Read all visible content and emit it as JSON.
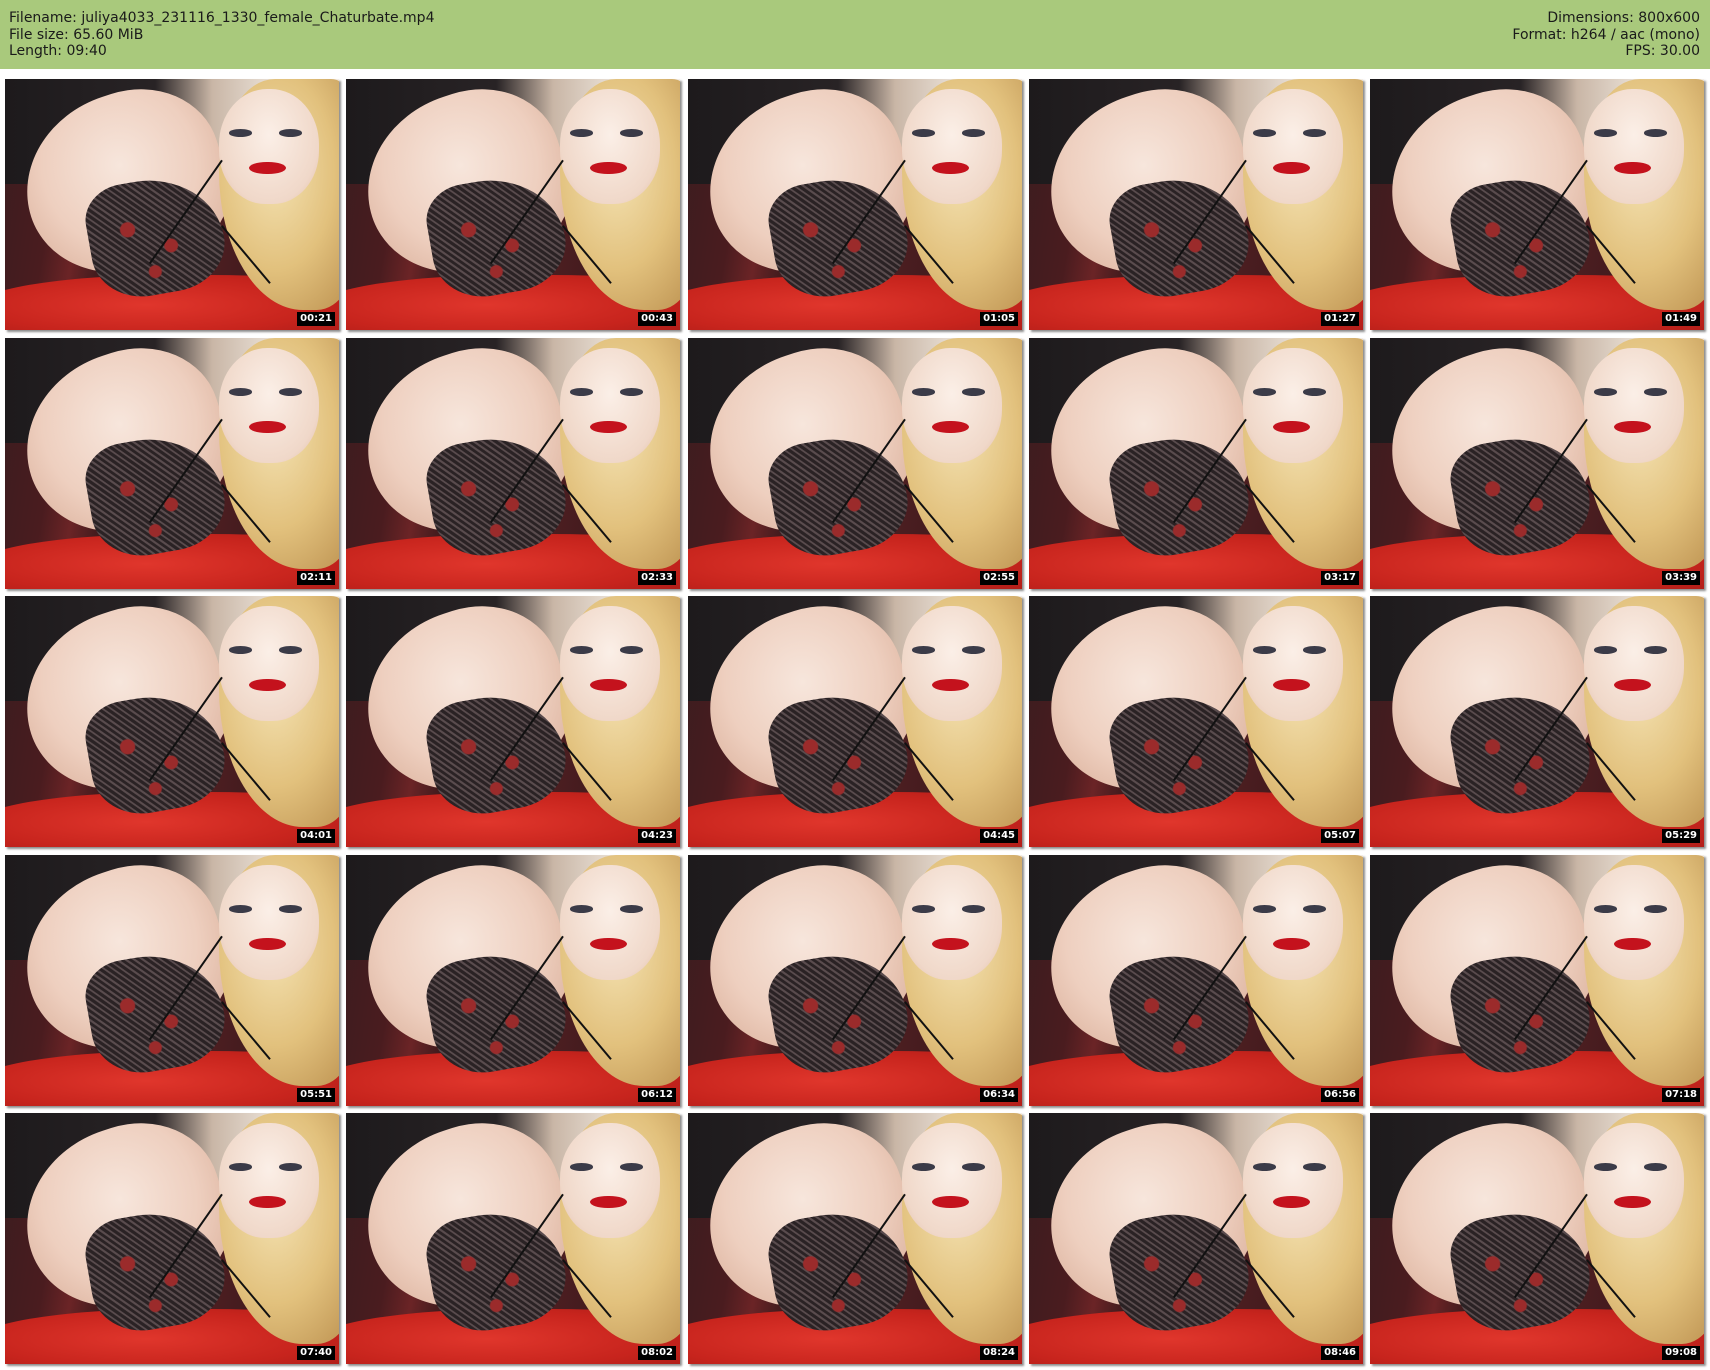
{
  "header": {
    "filename_label": "Filename:",
    "filename": "juliya4033_231116_1330_female_Chaturbate.mp4",
    "filesize_label": "File size:",
    "filesize": "65.60 MiB",
    "length_label": "Length:",
    "length": "09:40",
    "dimensions_label": "Dimensions:",
    "dimensions": "800x600",
    "format_label": "Format:",
    "format": "h264 / aac (mono)",
    "fps_label": "FPS:",
    "fps": "30.00",
    "background_color": "#a9c97c"
  },
  "thumbnails": [
    {
      "timestamp": "00:21"
    },
    {
      "timestamp": "00:43"
    },
    {
      "timestamp": "01:05"
    },
    {
      "timestamp": "01:27"
    },
    {
      "timestamp": "01:49"
    },
    {
      "timestamp": "02:11"
    },
    {
      "timestamp": "02:33"
    },
    {
      "timestamp": "02:55"
    },
    {
      "timestamp": "03:17"
    },
    {
      "timestamp": "03:39"
    },
    {
      "timestamp": "04:01"
    },
    {
      "timestamp": "04:23"
    },
    {
      "timestamp": "04:45"
    },
    {
      "timestamp": "05:07"
    },
    {
      "timestamp": "05:29"
    },
    {
      "timestamp": "05:51"
    },
    {
      "timestamp": "06:12"
    },
    {
      "timestamp": "06:34"
    },
    {
      "timestamp": "06:56"
    },
    {
      "timestamp": "07:18"
    },
    {
      "timestamp": "07:40"
    },
    {
      "timestamp": "08:02"
    },
    {
      "timestamp": "08:24"
    },
    {
      "timestamp": "08:46"
    },
    {
      "timestamp": "09:08"
    }
  ]
}
